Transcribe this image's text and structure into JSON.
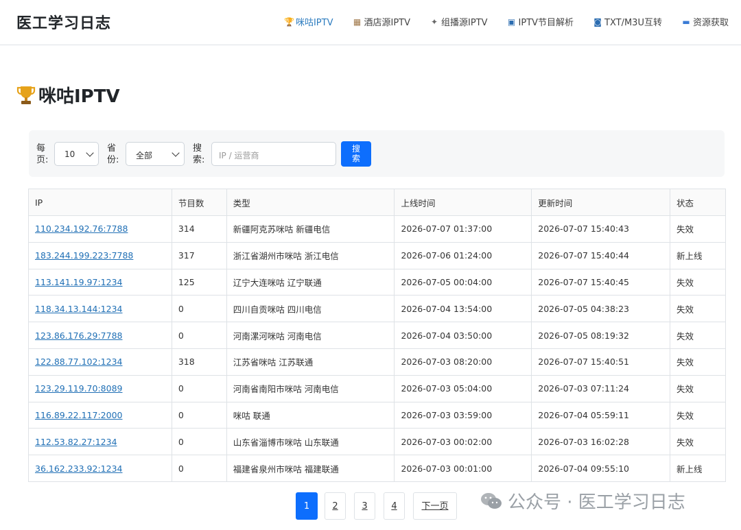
{
  "header": {
    "brand": "医工学习日志",
    "nav": [
      {
        "icon": "trophy-icon",
        "label": "咪咕IPTV",
        "glyph": "🏆",
        "color": "#d4a017"
      },
      {
        "icon": "hotel-icon",
        "label": "酒店源IPTV",
        "glyph": "▦",
        "color": "#a0784a"
      },
      {
        "icon": "satellite-icon",
        "label": "组播源IPTV",
        "glyph": "✦",
        "color": "#666"
      },
      {
        "icon": "tv-icon",
        "label": "IPTV节目解析",
        "glyph": "▣",
        "color": "#2b6cb0"
      },
      {
        "icon": "convert-icon",
        "label": "TXT/M3U互转",
        "glyph": "◙",
        "color": "#2b6cb0"
      },
      {
        "icon": "computer-icon",
        "label": "资源获取",
        "glyph": "▬",
        "color": "#3a7bd5"
      }
    ]
  },
  "page": {
    "title": "咪咕IPTV"
  },
  "filters": {
    "per_page_label": "每页:",
    "per_page_value": "10",
    "province_label": "省份:",
    "province_value": "全部",
    "search_label": "搜索:",
    "search_placeholder": "IP / 运营商",
    "search_button": "搜索"
  },
  "table": {
    "headers": [
      "IP",
      "节目数",
      "类型",
      "上线时间",
      "更新时间",
      "状态"
    ],
    "rows": [
      {
        "ip": "110.234.192.76:7788",
        "count": "314",
        "type": "新疆阿克苏咪咕 新疆电信",
        "online": "2026-07-07 01:37:00",
        "updated": "2026-07-07 15:40:43",
        "status": "失效",
        "status_kind": "fail"
      },
      {
        "ip": "183.244.199.223:7788",
        "count": "317",
        "type": "浙江省湖州市咪咕 浙江电信",
        "online": "2026-07-06 01:24:00",
        "updated": "2026-07-07 15:40:44",
        "status": "新上线",
        "status_kind": "new"
      },
      {
        "ip": "113.141.19.97:1234",
        "count": "125",
        "type": "辽宁大连咪咕 辽宁联通",
        "online": "2026-07-05 00:04:00",
        "updated": "2026-07-07 15:40:45",
        "status": "失效",
        "status_kind": "fail"
      },
      {
        "ip": "118.34.13.144:1234",
        "count": "0",
        "type": "四川自贡咪咕 四川电信",
        "online": "2026-07-04 13:54:00",
        "updated": "2026-07-05 04:38:23",
        "status": "失效",
        "status_kind": "fail"
      },
      {
        "ip": "123.86.176.29:7788",
        "count": "0",
        "type": "河南漯河咪咕 河南电信",
        "online": "2026-07-04 03:50:00",
        "updated": "2026-07-05 08:19:32",
        "status": "失效",
        "status_kind": "fail"
      },
      {
        "ip": "122.88.77.102:1234",
        "count": "318",
        "type": "江苏省咪咕 江苏联通",
        "online": "2026-07-03 08:20:00",
        "updated": "2026-07-07 15:40:51",
        "status": "失效",
        "status_kind": "fail"
      },
      {
        "ip": "123.29.119.70:8089",
        "count": "0",
        "type": "河南省南阳市咪咕 河南电信",
        "online": "2026-07-03 05:04:00",
        "updated": "2026-07-03 07:11:24",
        "status": "失效",
        "status_kind": "fail"
      },
      {
        "ip": "116.89.22.117:2000",
        "count": "0",
        "type": "咪咕 联通",
        "online": "2026-07-03 03:59:00",
        "updated": "2026-07-04 05:59:11",
        "status": "失效",
        "status_kind": "fail"
      },
      {
        "ip": "112.53.82.27:1234",
        "count": "0",
        "type": "山东省淄博市咪咕 山东联通",
        "online": "2026-07-03 00:02:00",
        "updated": "2026-07-03 16:02:28",
        "status": "失效",
        "status_kind": "fail"
      },
      {
        "ip": "36.162.233.92:1234",
        "count": "0",
        "type": "福建省泉州市咪咕 福建联通",
        "online": "2026-07-03 00:01:00",
        "updated": "2026-07-04 09:55:10",
        "status": "新上线",
        "status_kind": "new"
      }
    ]
  },
  "pagination": {
    "pages": [
      "1",
      "2",
      "3",
      "4"
    ],
    "active": "1",
    "next_label": "下一页"
  },
  "watermark": {
    "text": "公众号 · 医工学习日志"
  },
  "colors": {
    "accent": "#0d6efd",
    "link": "#1f6fb5",
    "fail": "#d9534f",
    "new": "#28a745"
  }
}
